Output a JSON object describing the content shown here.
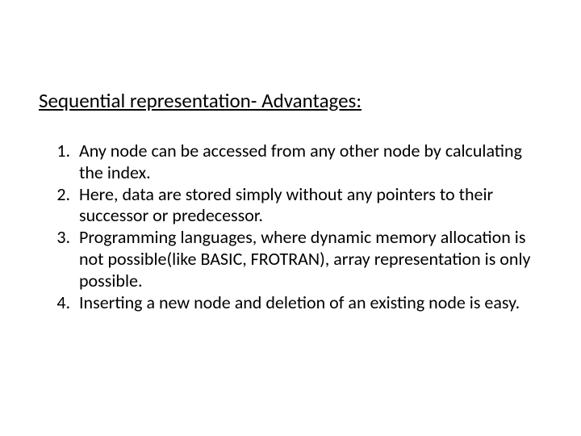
{
  "title": "Sequential representation- Advantages:",
  "items": [
    "Any node can be accessed from any other node by calculating the index.",
    "Here, data are stored simply without any pointers to their successor or predecessor.",
    "Programming languages, where dynamic memory allocation is not possible(like BASIC, FROTRAN), array representation is only possible.",
    "Inserting a new node and deletion of an existing node is easy."
  ]
}
